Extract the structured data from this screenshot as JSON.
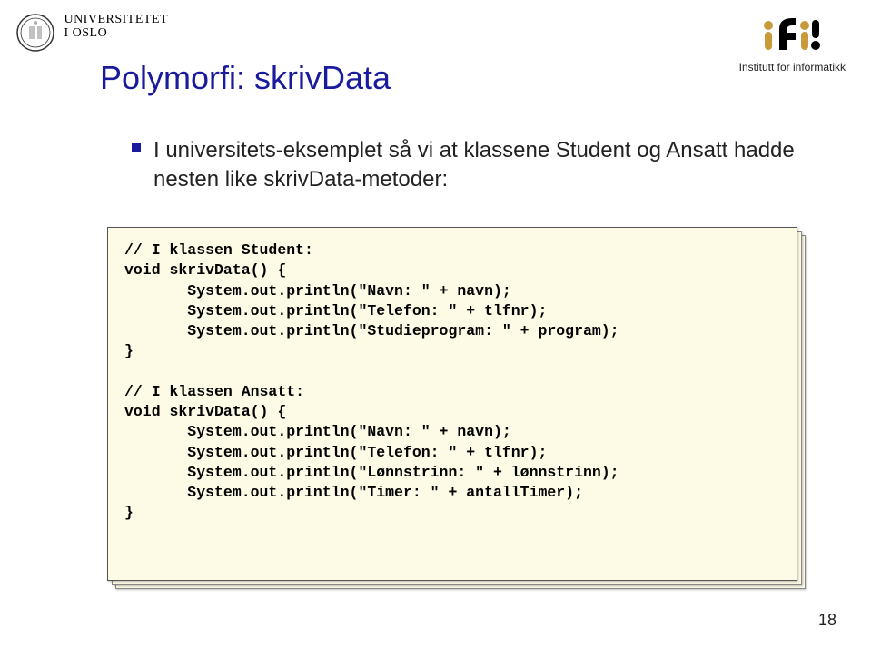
{
  "header": {
    "uio_line1": "UNIVERSITETET",
    "uio_line2": "I OSLO",
    "ifi_subtitle": "Institutt for informatikk"
  },
  "title": "Polymorfi: skrivData",
  "bullet": "I universitets-eksemplet så vi at klassene Student og Ansatt hadde nesten like skrivData-metoder:",
  "code": "// I klassen Student:\nvoid skrivData() {\n       System.out.println(\"Navn: \" + navn);\n       System.out.println(\"Telefon: \" + tlfnr);\n       System.out.println(\"Studieprogram: \" + program);\n}\n\n// I klassen Ansatt:\nvoid skrivData() {\n       System.out.println(\"Navn: \" + navn);\n       System.out.println(\"Telefon: \" + tlfnr);\n       System.out.println(\"Lønnstrinn: \" + lønnstrinn);\n       System.out.println(\"Timer: \" + antallTimer);\n}",
  "page_number": "18"
}
